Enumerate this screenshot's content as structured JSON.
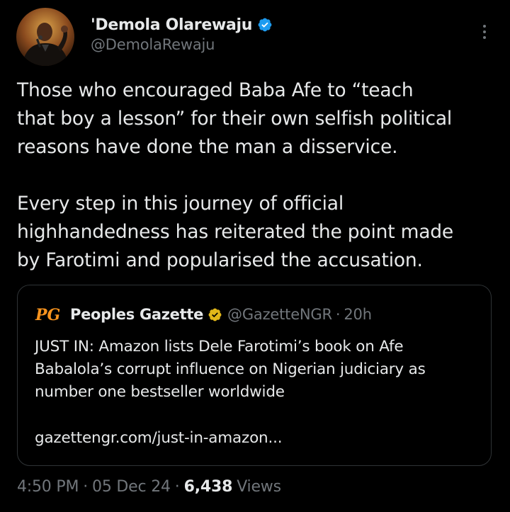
{
  "author": {
    "display_name": "'Demola Olarewaju",
    "handle": "@DemolaRewaju",
    "verified_icon": "verified-badge-blue",
    "avatar": "profile-photo"
  },
  "tweet": {
    "paragraphs": [
      "Those who encouraged Baba Afe to “teach\nthat boy a lesson” for their own selfish political\nreasons have done the man a disservice.",
      "Every step in this journey of official\nhighhandedness has reiterated the point made\nby Farotimi and popularised the accusation."
    ]
  },
  "quote": {
    "logo_text": "PG",
    "display_name": "Peoples Gazette",
    "verified_icon": "verified-badge-gold",
    "handle": "@GazetteNGR",
    "separator": "·",
    "time": "20h",
    "text": "JUST IN: Amazon lists Dele Farotimi’s book on Afe\nBabalola’s corrupt influence on Nigerian judiciary as\nnumber one bestseller worldwide",
    "link": "gazettengr.com/just-in-amazon..."
  },
  "footer": {
    "time": "4:50 PM",
    "separator1": "·",
    "date": "05 Dec 24",
    "separator2": "·",
    "views_count": "6,438",
    "views_label": "Views"
  },
  "colors": {
    "background": "#000000",
    "text_primary": "#e7e9ea",
    "text_secondary": "#71767b",
    "border": "#2f3336",
    "verified_blue": "#1d9bf0",
    "verified_gold": "#e2b719",
    "logo_orange": "#f7931e"
  }
}
